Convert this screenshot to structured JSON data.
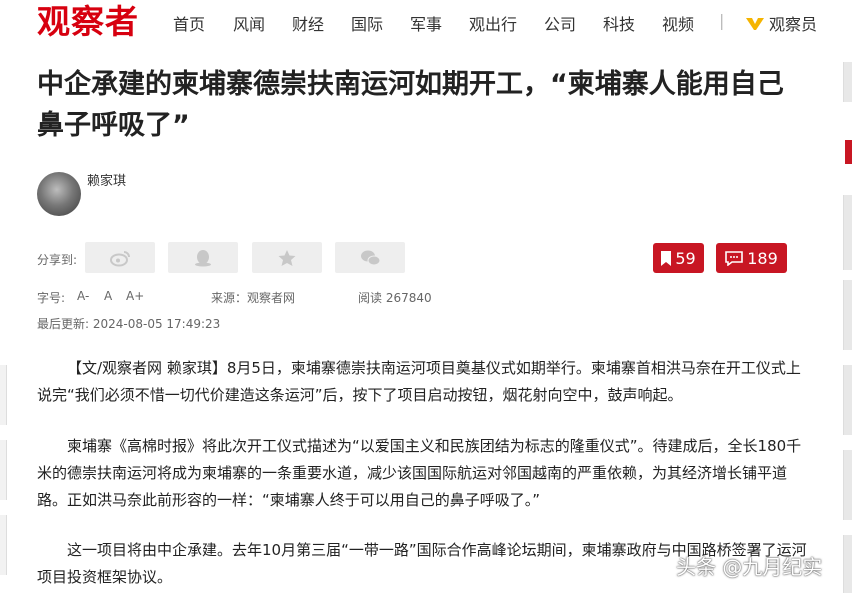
{
  "header": {
    "logo": "观察者",
    "nav": [
      "首页",
      "风闻",
      "财经",
      "国际",
      "军事",
      "观出行",
      "公司",
      "科技",
      "视频"
    ],
    "separator": "|",
    "member_label": "观察员"
  },
  "article": {
    "title": "中企承建的柬埔寨德崇扶南运河如期开工，“柬埔寨人能用自己鼻子呼吸了”",
    "author": "赖家琪",
    "share_label": "分享到:",
    "bookmark_count": "59",
    "comment_count": "189",
    "font_size_label": "字号:",
    "font_small": "A-",
    "font_normal": "A",
    "font_large": "A+",
    "source": "来源：观察者网",
    "views": "阅读 267840",
    "updated": "最后更新: 2024-08-05 17:49:23",
    "paragraphs": [
      "【文/观察者网 赖家琪】8月5日，柬埔寨德崇扶南运河项目奠基仪式如期举行。柬埔寨首相洪马奈在开工仪式上说完“我们必须不惜一切代价建造这条运河”后，按下了项目启动按钮，烟花射向空中，鼓声响起。",
      "柬埔寨《高棉时报》将此次开工仪式描述为“以爱国主义和民族团结为标志的隆重仪式”。待建成后，全长180千米的德崇扶南运河将成为柬埔寨的一条重要水道，减少该国国际航运对邻国越南的严重依赖，为其经济增长铺平道路。正如洪马奈此前形容的一样：“柬埔寨人终于可以用自己的鼻子呼吸了。”",
      "这一项目将由中企承建。去年10月第三届“一带一路”国际合作高峰论坛期间，柬埔寨政府与中国路桥签署了运河项目投资框架协议。"
    ]
  },
  "watermark": "头条 @九月纪实",
  "icons": {
    "share": [
      "weibo-icon",
      "qq-icon",
      "qzone-star-icon",
      "wechat-icon"
    ],
    "bookmark": "bookmark-icon",
    "comment": "comment-icon",
    "member": "member-badge-icon"
  },
  "colors": {
    "brand": "#d7000f",
    "button_red": "#c81623",
    "badge_yellow": "#f5b400"
  }
}
